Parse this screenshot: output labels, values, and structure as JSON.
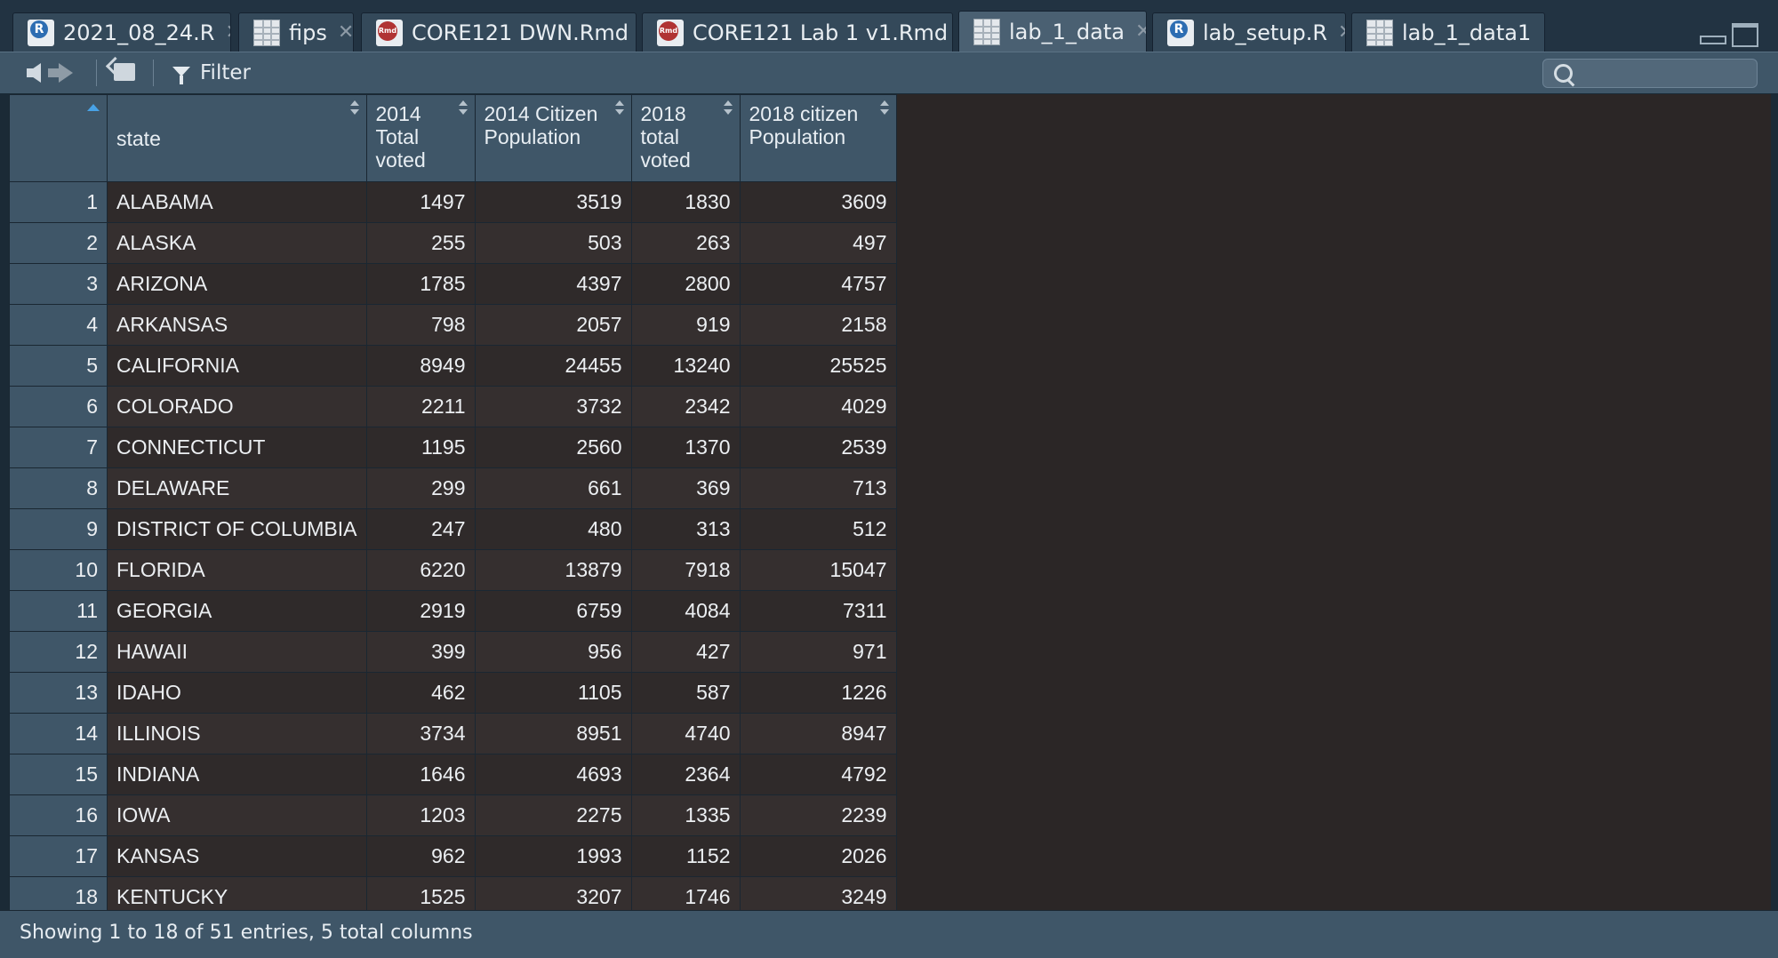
{
  "tabs": [
    {
      "label": "2021_08_24.R",
      "icon": "r-file-icon"
    },
    {
      "label": "fips",
      "icon": "data-grid-icon"
    },
    {
      "label": "CORE121 DWN.Rmd",
      "icon": "rmd-file-icon"
    },
    {
      "label": "CORE121 Lab 1 v1.Rmd",
      "icon": "rmd-file-icon"
    },
    {
      "label": "lab_1_data",
      "icon": "data-grid-icon",
      "active": true
    },
    {
      "label": "lab_setup.R",
      "icon": "r-file-icon"
    },
    {
      "label": "lab_1_data1",
      "icon": "data-grid-icon"
    }
  ],
  "icon_text": {
    "r": "R",
    "rmd": "Rmd"
  },
  "toolbar": {
    "filter_label": "Filter",
    "search_value": ""
  },
  "table": {
    "columns": [
      "state",
      "2014 Total voted",
      "2014 Citizen Population",
      "2018 total voted",
      "2018 citizen Population"
    ],
    "rows": [
      [
        "1",
        "ALABAMA",
        "1497",
        "3519",
        "1830",
        "3609"
      ],
      [
        "2",
        "ALASKA",
        "255",
        "503",
        "263",
        "497"
      ],
      [
        "3",
        "ARIZONA",
        "1785",
        "4397",
        "2800",
        "4757"
      ],
      [
        "4",
        "ARKANSAS",
        "798",
        "2057",
        "919",
        "2158"
      ],
      [
        "5",
        "CALIFORNIA",
        "8949",
        "24455",
        "13240",
        "25525"
      ],
      [
        "6",
        "COLORADO",
        "2211",
        "3732",
        "2342",
        "4029"
      ],
      [
        "7",
        "CONNECTICUT",
        "1195",
        "2560",
        "1370",
        "2539"
      ],
      [
        "8",
        "DELAWARE",
        "299",
        "661",
        "369",
        "713"
      ],
      [
        "9",
        "DISTRICT OF COLUMBIA",
        "247",
        "480",
        "313",
        "512"
      ],
      [
        "10",
        "FLORIDA",
        "6220",
        "13879",
        "7918",
        "15047"
      ],
      [
        "11",
        "GEORGIA",
        "2919",
        "6759",
        "4084",
        "7311"
      ],
      [
        "12",
        "HAWAII",
        "399",
        "956",
        "427",
        "971"
      ],
      [
        "13",
        "IDAHO",
        "462",
        "1105",
        "587",
        "1226"
      ],
      [
        "14",
        "ILLINOIS",
        "3734",
        "8951",
        "4740",
        "8947"
      ],
      [
        "15",
        "INDIANA",
        "1646",
        "4693",
        "2364",
        "4792"
      ],
      [
        "16",
        "IOWA",
        "1203",
        "2275",
        "1335",
        "2239"
      ],
      [
        "17",
        "KANSAS",
        "962",
        "1993",
        "1152",
        "2026"
      ],
      [
        "18",
        "KENTUCKY",
        "1525",
        "3207",
        "1746",
        "3249"
      ]
    ]
  },
  "status": {
    "text": "Showing 1 to 18 of 51 entries, 5 total columns"
  },
  "colors": {
    "accent": "#48a2e6",
    "header_bg": "#3f5668",
    "cell_bg": "#2f2a2a",
    "empty_bg": "#2b2626"
  }
}
